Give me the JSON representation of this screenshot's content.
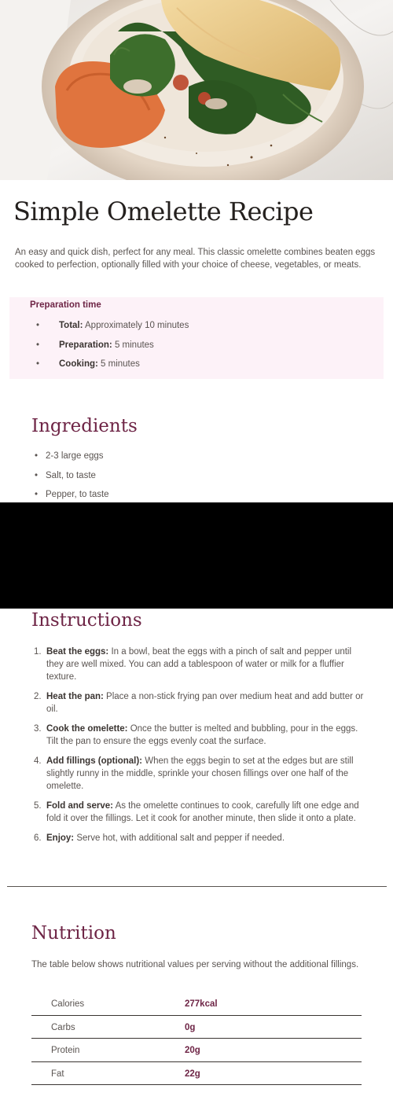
{
  "title": "Simple Omelette Recipe",
  "intro": "An easy and quick dish, perfect for any meal. This classic omelette combines beaten eggs cooked to perfection, optionally filled with your choice of cheese, vegetables, or meats.",
  "preparation": {
    "title": "Preparation time",
    "items": [
      {
        "label": "Total:",
        "value": "Approximately 10 minutes"
      },
      {
        "label": "Preparation:",
        "value": "5 minutes"
      },
      {
        "label": "Cooking:",
        "value": "5 minutes"
      }
    ]
  },
  "ingredients": {
    "title": "Ingredients",
    "items": [
      "2-3 large eggs",
      "Salt, to taste",
      "Pepper, to taste"
    ]
  },
  "instructions": {
    "title": "Instructions",
    "steps": [
      {
        "num": "1.",
        "label": "Beat the eggs:",
        "text": "In a bowl, beat the eggs with a pinch of salt and pepper until they are well mixed. You can add a tablespoon of water or milk for a fluffier texture."
      },
      {
        "num": "2.",
        "label": "Heat the pan:",
        "text": "Place a non-stick frying pan over medium heat and add butter or oil."
      },
      {
        "num": "3.",
        "label": "Cook the omelette:",
        "text": "Once the butter is melted and bubbling, pour in the eggs. Tilt the pan to ensure the eggs evenly coat the surface."
      },
      {
        "num": "4.",
        "label": "Add fillings (optional):",
        "text": "When the eggs begin to set at the edges but are still slightly runny in the middle, sprinkle your chosen fillings over one half of the omelette."
      },
      {
        "num": "5.",
        "label": "Fold and serve:",
        "text": "As the omelette continues to cook, carefully lift one edge and fold it over the fillings. Let it cook for another minute, then slide it onto a plate."
      },
      {
        "num": "6.",
        "label": "Enjoy:",
        "text": "Serve hot, with additional salt and pepper if needed."
      }
    ]
  },
  "nutrition": {
    "title": "Nutrition",
    "description": "The table below shows nutritional values per serving without the additional fillings.",
    "rows": [
      {
        "name": "Calories",
        "value": "277kcal"
      },
      {
        "name": "Carbs",
        "value": "0g"
      },
      {
        "name": "Protein",
        "value": "20g"
      },
      {
        "name": "Fat",
        "value": "22g"
      }
    ]
  },
  "colors": {
    "accent": "#6e2546",
    "prep_background": "#fdf2f8",
    "text": "#5a5451",
    "heading": "#24201e"
  }
}
